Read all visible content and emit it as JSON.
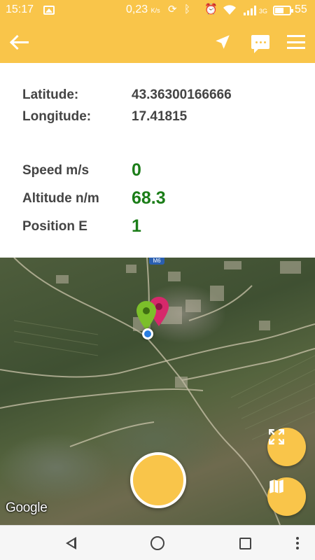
{
  "status_bar": {
    "time": "15:17",
    "gallery_icon": "image-icon",
    "net_speed": "0,23",
    "net_speed_unit": "K/s",
    "sync_icon": "sync-icon",
    "bluetooth_icon": "bluetooth-icon",
    "alarm_icon": "alarm-icon",
    "wifi_icon": "wifi-icon",
    "signal_icon": "signal-icon",
    "network_type": "3G",
    "battery_percent": "55"
  },
  "toolbar": {
    "back_icon": "arrow-back-icon",
    "navigate_icon": "navigation-arrow-icon",
    "message_icon": "chat-bubble-icon",
    "menu_icon": "hamburger-menu-icon",
    "background_color": "#f9c54a"
  },
  "info": {
    "latitude_label": "Latitude:",
    "latitude_value": "43.36300166666",
    "longitude_label": "Longitude:",
    "longitude_value": "17.41815",
    "speed_label": "Speed m/s",
    "speed_value": "0",
    "altitude_label": "Altitude n/m",
    "altitude_value": "68.3",
    "position_label": "Position E",
    "position_value": "1",
    "value_color": "#1b7d18"
  },
  "map": {
    "road_badge": "M6",
    "attribution": "Google",
    "green_marker_icon": "map-pin-green-icon",
    "red_marker_icon": "map-pin-red-icon",
    "location_icon": "my-location-dot-icon",
    "fullscreen_icon": "expand-icon",
    "map_type_icon": "map-icon"
  },
  "nav_bar": {
    "back_icon": "triangle-back-icon",
    "home_icon": "circle-home-icon",
    "recents_icon": "square-recents-icon",
    "more_icon": "more-vertical-icon"
  }
}
